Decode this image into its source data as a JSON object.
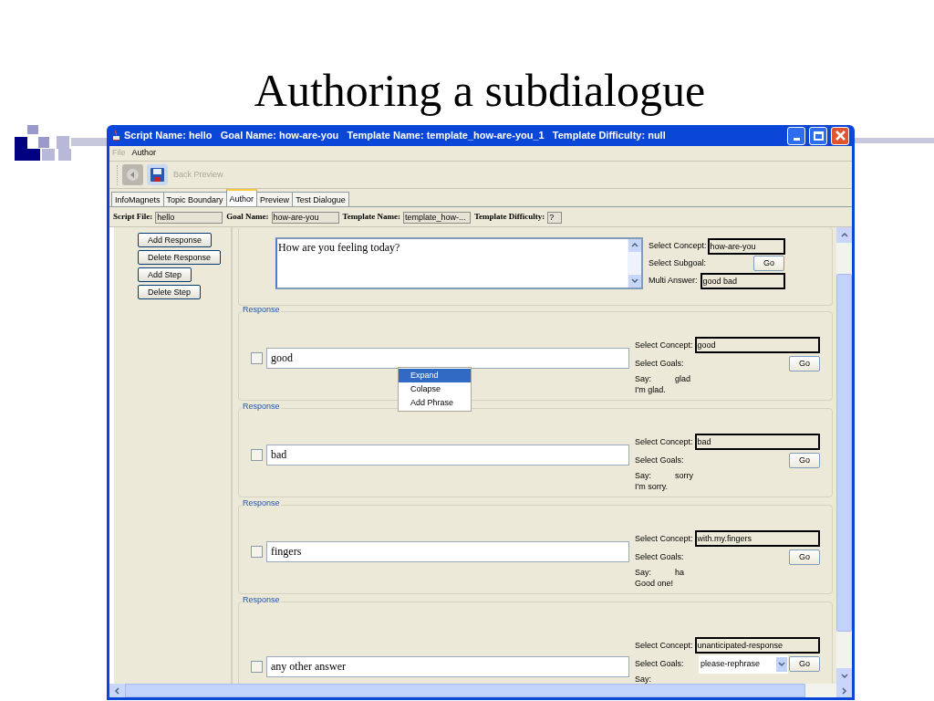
{
  "slide_title": "Authoring a subdialogue",
  "window": {
    "title": "Script Name: hello   Goal Name: how-are-you   Template Name: template_how-are-you_1   Template Difficulty: null"
  },
  "menu": [
    {
      "label": "File",
      "disabled": true
    },
    {
      "label": "Author",
      "disabled": false
    }
  ],
  "toolbar": [
    {
      "kind": "back",
      "disabled": true
    },
    {
      "kind": "save",
      "disabled": false
    },
    {
      "kind": "text",
      "label": "Back Preview",
      "disabled": true
    }
  ],
  "tabs": [
    {
      "label": "InfoMagnets",
      "selected": false
    },
    {
      "label": "Topic Boundary",
      "selected": false
    },
    {
      "label": "Author",
      "selected": true
    },
    {
      "label": "Preview",
      "selected": false
    },
    {
      "label": "Test Dialogue",
      "selected": false
    }
  ],
  "info_fields": [
    {
      "label": "Script File:",
      "value": "hello"
    },
    {
      "label": "Goal Name:",
      "value": "how-are-you"
    },
    {
      "label": "Template Name:",
      "value": "template_how-..."
    },
    {
      "label": "Template Difficulty:",
      "value": "?"
    }
  ],
  "side_buttons": [
    "Add Response",
    "Delete Response",
    "Add Step",
    "Delete Step"
  ],
  "prompt": {
    "text": "How are you feeling today?",
    "concept_label": "Select Concept:",
    "concept": "how-are-you",
    "subgoal_label": "Select Subgoal:",
    "go": "Go",
    "multi_label": "Multi Answer:",
    "multi": "good  bad"
  },
  "responses": [
    {
      "legend": "Response",
      "text": "good",
      "checked": false,
      "concept_label": "Select Concept:",
      "concept": "good",
      "goals_label": "Select Goals:",
      "go": "Go",
      "say_label": "Say:",
      "say_key": "glad",
      "say_text": "I'm glad."
    },
    {
      "legend": "Response",
      "text": "bad",
      "checked": false,
      "concept_label": "Select Concept:",
      "concept": "bad",
      "goals_label": "Select Goals:",
      "go": "Go",
      "say_label": "Say:",
      "say_key": "sorry",
      "say_text": "I'm sorry."
    },
    {
      "legend": "Response",
      "text": "fingers",
      "checked": false,
      "concept_label": "Select Concept:",
      "concept": "with.my.fingers",
      "goals_label": "Select Goals:",
      "go": "Go",
      "say_label": "Say:",
      "say_key": "ha",
      "say_text": "Good one!"
    },
    {
      "legend": "Response",
      "text": "any other answer",
      "checked": false,
      "concept_label": "Select Concept:",
      "concept": "unanticipated-response",
      "goals_label": "Select Goals:",
      "goals_value": "please-rephrase",
      "go": "Go",
      "say_label": "Say:"
    }
  ],
  "context_menu": [
    {
      "label": "Expand",
      "selected": true
    },
    {
      "label": "Colapse",
      "selected": false
    },
    {
      "label": "Add Phrase",
      "selected": false
    }
  ]
}
